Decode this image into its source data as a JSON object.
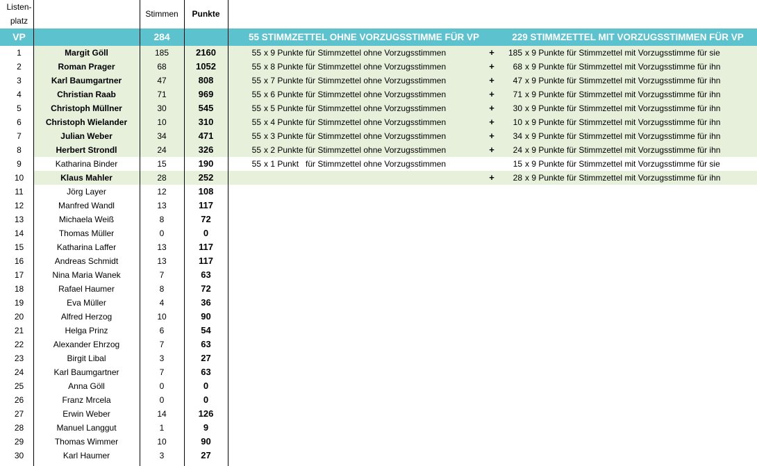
{
  "header": {
    "listenplatz": "Listen-\nplatz",
    "listenplatz_1": "Listen-",
    "listenplatz_2": "platz",
    "stimmen": "Stimmen",
    "punkte": "Punkte"
  },
  "party": {
    "label": "VP",
    "total": "284",
    "ohne_label": "55 STIMMZETTEL OHNE VORZUGSSTIMME FÜR VP",
    "mit_label": "229 STIMMZETTEL MIT VORZUGSSTIMMEN FÜR VP"
  },
  "colors": {
    "band": "#5bc2ce",
    "highlight": "#e6f0da"
  },
  "rows": [
    {
      "nr": "1",
      "name": "Margit Göll",
      "stimmen": "185",
      "punkte": "2160",
      "hl": true,
      "f1n": "55",
      "f1": "x 9 Punkte für Stimmzettel ohne Vorzugsstimmen",
      "plus": "+",
      "f2n": "185",
      "f2": "x 9 Punkte für Stimmzettel mit Vorzugsstimme für sie"
    },
    {
      "nr": "2",
      "name": "Roman Prager",
      "stimmen": "68",
      "punkte": "1052",
      "hl": true,
      "f1n": "55",
      "f1": "x 8 Punkte für Stimmzettel ohne Vorzugsstimmen",
      "plus": "+",
      "f2n": "68",
      "f2": "x 9 Punkte für Stimmzettel mit Vorzugsstimme für ihn"
    },
    {
      "nr": "3",
      "name": "Karl Baumgartner",
      "stimmen": "47",
      "punkte": "808",
      "hl": true,
      "f1n": "55",
      "f1": "x 7 Punkte für Stimmzettel ohne Vorzugsstimmen",
      "plus": "+",
      "f2n": "47",
      "f2": "x 9 Punkte für Stimmzettel mit Vorzugsstimme für ihn"
    },
    {
      "nr": "4",
      "name": "Christian Raab",
      "stimmen": "71",
      "punkte": "969",
      "hl": true,
      "f1n": "55",
      "f1": "x 6 Punkte für Stimmzettel ohne Vorzugsstimmen",
      "plus": "+",
      "f2n": "71",
      "f2": "x 9 Punkte für Stimmzettel mit Vorzugsstimme für ihn"
    },
    {
      "nr": "5",
      "name": "Christoph Müllner",
      "stimmen": "30",
      "punkte": "545",
      "hl": true,
      "f1n": "55",
      "f1": "x 5 Punkte für Stimmzettel ohne Vorzugsstimmen",
      "plus": "+",
      "f2n": "30",
      "f2": "x 9 Punkte für Stimmzettel mit Vorzugsstimme für ihn"
    },
    {
      "nr": "6",
      "name": "Christoph Wielander",
      "stimmen": "10",
      "punkte": "310",
      "hl": true,
      "f1n": "55",
      "f1": "x 4 Punkte für Stimmzettel ohne Vorzugsstimmen",
      "plus": "+",
      "f2n": "10",
      "f2": "x 9 Punkte für Stimmzettel mit Vorzugsstimme für ihn"
    },
    {
      "nr": "7",
      "name": "Julian Weber",
      "stimmen": "34",
      "punkte": "471",
      "hl": true,
      "f1n": "55",
      "f1": "x 3 Punkte für Stimmzettel ohne Vorzugsstimmen",
      "plus": "+",
      "f2n": "34",
      "f2": "x 9 Punkte für Stimmzettel mit Vorzugsstimme für ihn"
    },
    {
      "nr": "8",
      "name": "Herbert Strondl",
      "stimmen": "24",
      "punkte": "326",
      "hl": true,
      "f1n": "55",
      "f1": "x 2 Punkte für Stimmzettel ohne Vorzugsstimmen",
      "plus": "+",
      "f2n": "24",
      "f2": "x 9 Punkte für Stimmzettel mit Vorzugsstimme für ihn"
    },
    {
      "nr": "9",
      "name": "Katharina Binder",
      "stimmen": "15",
      "punkte": "190",
      "hl": false,
      "f1n": "55",
      "f1": "x 1 Punkt   für Stimmzettel ohne Vorzugsstimmen",
      "plus": "",
      "f2n": "15",
      "f2": "x 9 Punkte für Stimmzettel mit Vorzugsstimme für sie"
    },
    {
      "nr": "10",
      "name": "Klaus Mahler",
      "stimmen": "28",
      "punkte": "252",
      "hl": true,
      "f1n": "",
      "f1": "",
      "plus": "+",
      "f2n": "28",
      "f2": "x 9 Punkte für Stimmzettel mit Vorzugsstimme für ihn"
    },
    {
      "nr": "11",
      "name": "Jörg Layer",
      "stimmen": "12",
      "punkte": "108"
    },
    {
      "nr": "12",
      "name": "Manfred Wandl",
      "stimmen": "13",
      "punkte": "117"
    },
    {
      "nr": "13",
      "name": "Michaela Weiß",
      "stimmen": "8",
      "punkte": "72"
    },
    {
      "nr": "14",
      "name": "Thomas Müller",
      "stimmen": "0",
      "punkte": "0"
    },
    {
      "nr": "15",
      "name": "Katharina Laffer",
      "stimmen": "13",
      "punkte": "117"
    },
    {
      "nr": "16",
      "name": "Andreas Schmidt",
      "stimmen": "13",
      "punkte": "117"
    },
    {
      "nr": "17",
      "name": "Nina Maria Wanek",
      "stimmen": "7",
      "punkte": "63"
    },
    {
      "nr": "18",
      "name": "Rafael Haumer",
      "stimmen": "8",
      "punkte": "72"
    },
    {
      "nr": "19",
      "name": "Eva Müller",
      "stimmen": "4",
      "punkte": "36"
    },
    {
      "nr": "20",
      "name": "Alfred Herzog",
      "stimmen": "10",
      "punkte": "90"
    },
    {
      "nr": "21",
      "name": "Helga Prinz",
      "stimmen": "6",
      "punkte": "54"
    },
    {
      "nr": "22",
      "name": "Alexander Ehrzog",
      "stimmen": "7",
      "punkte": "63"
    },
    {
      "nr": "23",
      "name": "Birgit Libal",
      "stimmen": "3",
      "punkte": "27"
    },
    {
      "nr": "24",
      "name": "Karl Baumgartner",
      "stimmen": "7",
      "punkte": "63"
    },
    {
      "nr": "25",
      "name": "Anna Göll",
      "stimmen": "0",
      "punkte": "0"
    },
    {
      "nr": "26",
      "name": "Franz Mrcela",
      "stimmen": "0",
      "punkte": "0"
    },
    {
      "nr": "27",
      "name": "Erwin Weber",
      "stimmen": "14",
      "punkte": "126"
    },
    {
      "nr": "28",
      "name": "Manuel Langgut",
      "stimmen": "1",
      "punkte": "9"
    },
    {
      "nr": "29",
      "name": "Thomas Wimmer",
      "stimmen": "10",
      "punkte": "90"
    },
    {
      "nr": "30",
      "name": "Karl Haumer",
      "stimmen": "3",
      "punkte": "27"
    }
  ]
}
